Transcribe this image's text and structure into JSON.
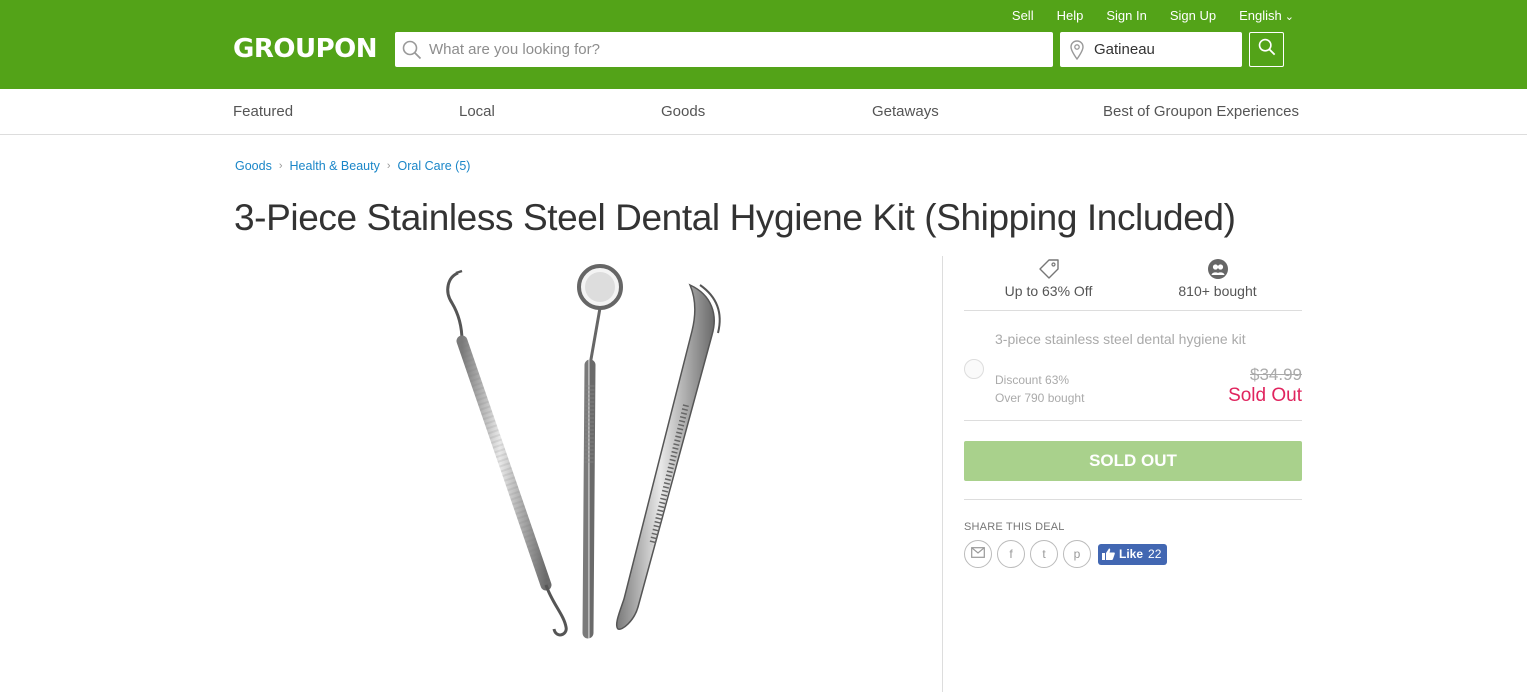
{
  "header": {
    "logo": "GROUPON",
    "links": {
      "sell": "Sell",
      "help": "Help",
      "sign_in": "Sign In",
      "sign_up": "Sign Up",
      "language": "English"
    },
    "search_placeholder": "What are you looking for?",
    "location": "Gatineau"
  },
  "nav": {
    "featured": "Featured",
    "local": "Local",
    "goods": "Goods",
    "getaways": "Getaways",
    "experiences": "Best of Groupon Experiences"
  },
  "breadcrumb": {
    "goods": "Goods",
    "health_beauty": "Health & Beauty",
    "oral_care": "Oral Care (5)",
    "sep": "›"
  },
  "product": {
    "title": "3-Piece Stainless Steel Dental Hygiene Kit (Shipping Included)"
  },
  "stats": {
    "discount": "Up to 63% Off",
    "bought": "810+ bought"
  },
  "option": {
    "title": "3-piece stainless steel dental hygiene kit",
    "discount": "Discount 63%",
    "bought": "Over 790 bought",
    "price": "$34.99",
    "status": "Sold Out"
  },
  "buy_button": "SOLD OUT",
  "share": {
    "label": "SHARE THIS DEAL",
    "like_label": "Like",
    "like_count": "22",
    "twitter_glyph": "t",
    "pinterest_glyph": "p",
    "facebook_glyph": "f"
  },
  "colors": {
    "brand_green": "#53a318",
    "sold_out_red": "#e0245e",
    "button_disabled": "#a9d18c",
    "link_blue": "#1a86c8",
    "facebook_blue": "#4267b2"
  },
  "icons": [
    "search-icon",
    "location-pin-icon",
    "tag-icon",
    "people-icon",
    "email-icon",
    "facebook-icon",
    "twitter-icon",
    "pinterest-icon",
    "thumbs-up-icon"
  ]
}
